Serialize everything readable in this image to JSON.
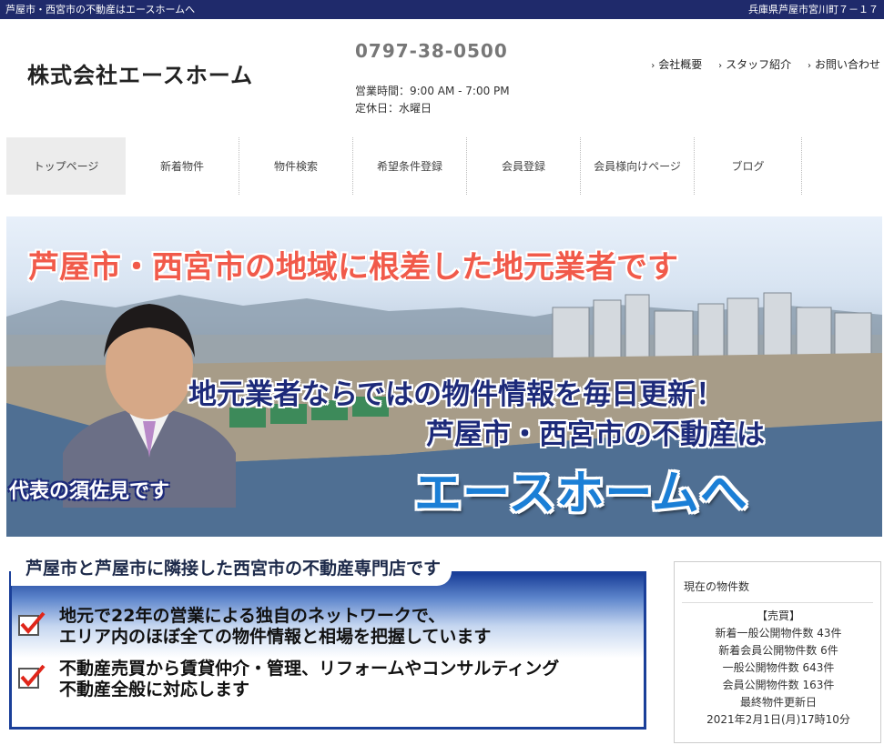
{
  "topbar": {
    "left_text": "芦屋市・西宮市の不動産はエースホームへ",
    "right_text": "兵庫県芦屋市宮川町７－１７"
  },
  "header": {
    "company": "株式会社エースホーム",
    "phone": "0797-38-0500",
    "hours": "営業時間：9:00 AM - 7:00 PM",
    "closed": "定休日：水曜日",
    "links": [
      "会社概要",
      "スタッフ紹介",
      "お問い合わせ"
    ]
  },
  "nav": {
    "tabs": [
      "トップページ",
      "新着物件",
      "物件検索",
      "希望条件登録",
      "会員登録",
      "会員様向けページ",
      "ブログ"
    ],
    "active_index": 0
  },
  "hero": {
    "headline": "芦屋市・西宮市の地域に根差した地元業者です",
    "line1": "地元業者ならではの物件情報を毎日更新！",
    "line2": "芦屋市・西宮市の不動産は",
    "line3": "エースホームへ",
    "caption": "代表の須佐見です"
  },
  "store": {
    "title": "芦屋市と芦屋市に隣接した西宮市の不動産専門店です",
    "points": [
      {
        "line1": "地元で22年の営業による独自のネットワークで、",
        "line2": "エリア内のほぼ全ての物件情報と相場を把握しています"
      },
      {
        "line1": "不動産売買から賃貸仲介・管理、リフォームやコンサルティング",
        "line2": "不動産全般に対応します"
      }
    ]
  },
  "side": {
    "heading": "現在の物件数",
    "section": "【売買】",
    "new_public": "新着一般公開物件数 43件",
    "new_member": "新着会員公開物件数 6件",
    "general_public": "一般公開物件数 643件",
    "member_public": "会員公開物件数 163件",
    "last_update_label": "最終物件更新日",
    "last_update": "2021年2月1日(月)17時10分"
  },
  "colors": {
    "topbar": "#1f2a6b",
    "headline_red": "#f15a4a",
    "navy_text": "#1d2a7a",
    "brand_blue": "#1b7fd6",
    "frame_blue": "#1a3f99",
    "check_red": "#e0261a"
  }
}
